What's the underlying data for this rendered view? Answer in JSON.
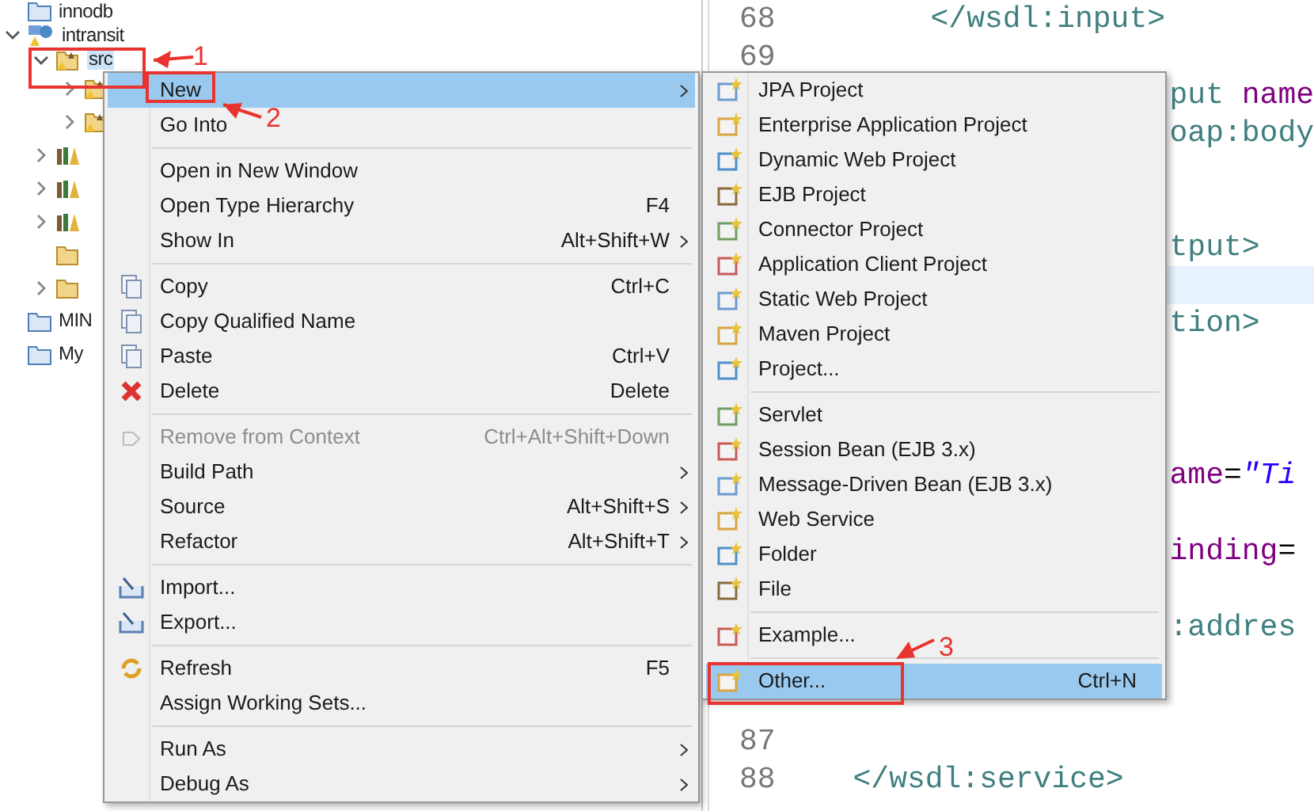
{
  "tree": {
    "items": [
      {
        "kind": "folder",
        "label": "innodb"
      },
      {
        "kind": "project",
        "label": "intransit",
        "expanded": true,
        "children": [
          {
            "kind": "package",
            "label": "src",
            "expanded": true,
            "selected": true,
            "children": [
              {
                "kind": "package",
                "expanded": false
              },
              {
                "kind": "package",
                "expanded": false
              }
            ]
          },
          {
            "kind": "library",
            "expanded": false
          },
          {
            "kind": "library",
            "expanded": false
          },
          {
            "kind": "library",
            "expanded": false
          },
          {
            "kind": "open_folder"
          },
          {
            "kind": "open_folder",
            "expanded": false
          }
        ]
      },
      {
        "kind": "folder",
        "label": "MIN"
      },
      {
        "kind": "folder",
        "label": "My"
      }
    ]
  },
  "editor": {
    "lines": [
      {
        "number": "68",
        "segments": [
          {
            "kind": "tag",
            "text": "</wsdl:input>"
          }
        ]
      },
      {
        "number": "69"
      },
      {
        "segments": [
          {
            "kind": "tag",
            "text": "put "
          },
          {
            "kind": "attr",
            "text": "name"
          }
        ]
      },
      {
        "segments": [
          {
            "kind": "tag",
            "text": "oap:body"
          }
        ]
      },
      {
        "segments": [
          {
            "kind": "tag",
            "text": "tput>"
          }
        ]
      },
      {
        "current": true
      },
      {
        "segments": [
          {
            "kind": "tag",
            "text": "tion>"
          }
        ]
      },
      {
        "segments": [
          {
            "kind": "attr",
            "text": "ame"
          },
          {
            "kind": "plain",
            "text": "="
          },
          {
            "kind": "value",
            "text": "\"Ti"
          }
        ]
      },
      {
        "segments": [
          {
            "kind": "attr",
            "text": "inding"
          },
          {
            "kind": "plain",
            "text": "="
          }
        ]
      },
      {
        "segments": [
          {
            "kind": "tag",
            "text": ":addres"
          }
        ]
      },
      {
        "number": "87"
      },
      {
        "number": "88",
        "segments": [
          {
            "kind": "tag",
            "text": "</wsdl:service>"
          }
        ]
      }
    ]
  },
  "context_menu": {
    "items": [
      {
        "kind": "item",
        "label": "New",
        "submenu": true,
        "selected": true,
        "disabled": false
      },
      {
        "kind": "item",
        "label": "Go Into",
        "selected": false,
        "disabled": false
      },
      {
        "kind": "separator"
      },
      {
        "kind": "item",
        "label": "Open in New Window",
        "selected": false,
        "disabled": false
      },
      {
        "kind": "item",
        "label": "Open Type Hierarchy",
        "shortcut": "F4",
        "selected": false,
        "disabled": false
      },
      {
        "kind": "item",
        "label": "Show In",
        "shortcut": "Alt+Shift+W",
        "submenu": true,
        "selected": false,
        "disabled": false
      },
      {
        "kind": "separator"
      },
      {
        "kind": "item",
        "label": "Copy",
        "shortcut": "Ctrl+C",
        "selected": false,
        "disabled": false
      },
      {
        "kind": "item",
        "label": "Copy Qualified Name",
        "selected": false,
        "disabled": false
      },
      {
        "kind": "item",
        "label": "Paste",
        "shortcut": "Ctrl+V",
        "selected": false,
        "disabled": false
      },
      {
        "kind": "item",
        "label": "Delete",
        "shortcut": "Delete",
        "selected": false,
        "disabled": false
      },
      {
        "kind": "separator"
      },
      {
        "kind": "item",
        "label": "Remove from Context",
        "shortcut": "Ctrl+Alt+Shift+Down",
        "selected": false,
        "disabled": true
      },
      {
        "kind": "item",
        "label": "Build Path",
        "submenu": true,
        "selected": false,
        "disabled": false
      },
      {
        "kind": "item",
        "label": "Source",
        "shortcut": "Alt+Shift+S",
        "submenu": true,
        "selected": false,
        "disabled": false
      },
      {
        "kind": "item",
        "label": "Refactor",
        "shortcut": "Alt+Shift+T",
        "submenu": true,
        "selected": false,
        "disabled": false
      },
      {
        "kind": "separator"
      },
      {
        "kind": "item",
        "label": "Import...",
        "selected": false,
        "disabled": false
      },
      {
        "kind": "item",
        "label": "Export...",
        "selected": false,
        "disabled": false
      },
      {
        "kind": "separator"
      },
      {
        "kind": "item",
        "label": "Refresh",
        "shortcut": "F5",
        "selected": false,
        "disabled": false
      },
      {
        "kind": "item",
        "label": "Assign Working Sets...",
        "selected": false,
        "disabled": false
      },
      {
        "kind": "separator"
      },
      {
        "kind": "item",
        "label": "Run As",
        "submenu": true,
        "selected": false,
        "disabled": false
      },
      {
        "kind": "item",
        "label": "Debug As",
        "submenu": true,
        "selected": false,
        "disabled": false
      }
    ]
  },
  "new_submenu": {
    "items": [
      {
        "kind": "item",
        "label": "JPA Project",
        "selected": false
      },
      {
        "kind": "item",
        "label": "Enterprise Application Project",
        "selected": false
      },
      {
        "kind": "item",
        "label": "Dynamic Web Project",
        "selected": false
      },
      {
        "kind": "item",
        "label": "EJB Project",
        "selected": false
      },
      {
        "kind": "item",
        "label": "Connector Project",
        "selected": false
      },
      {
        "kind": "item",
        "label": "Application Client Project",
        "selected": false
      },
      {
        "kind": "item",
        "label": "Static Web Project",
        "selected": false
      },
      {
        "kind": "item",
        "label": "Maven Project",
        "selected": false
      },
      {
        "kind": "item",
        "label": "Project...",
        "selected": false
      },
      {
        "kind": "separator"
      },
      {
        "kind": "item",
        "label": "Servlet",
        "selected": false
      },
      {
        "kind": "item",
        "label": "Session Bean (EJB 3.x)",
        "selected": false
      },
      {
        "kind": "item",
        "label": "Message-Driven Bean (EJB 3.x)",
        "selected": false
      },
      {
        "kind": "item",
        "label": "Web Service",
        "selected": false
      },
      {
        "kind": "item",
        "label": "Folder",
        "selected": false
      },
      {
        "kind": "item",
        "label": "File",
        "selected": false
      },
      {
        "kind": "separator"
      },
      {
        "kind": "item",
        "label": "Example...",
        "selected": false
      },
      {
        "kind": "separator"
      },
      {
        "kind": "item",
        "label": "Other...",
        "shortcut": "Ctrl+N",
        "selected": true
      }
    ]
  },
  "annotations": [
    {
      "label": "1"
    },
    {
      "label": "2"
    },
    {
      "label": "3"
    }
  ]
}
